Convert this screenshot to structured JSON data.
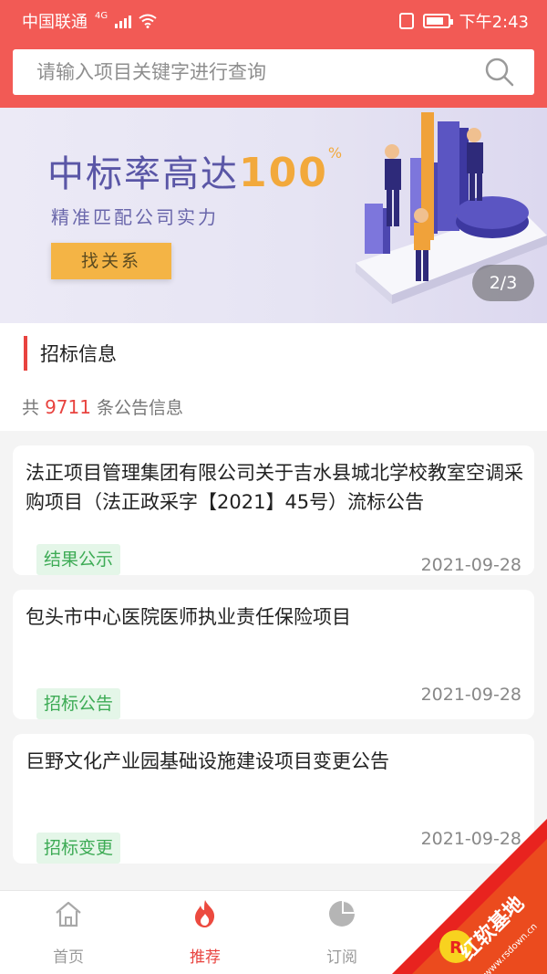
{
  "status_bar": {
    "carrier": "中国联通",
    "network": "4G",
    "time": "下午2:43"
  },
  "search": {
    "placeholder": "请输入项目关键字进行查询",
    "value": ""
  },
  "banner": {
    "title_prefix": "中标率高达",
    "title_highlight": "100",
    "title_percent": "%",
    "subtitle": "精准匹配公司实力",
    "button_label": "找关系",
    "pager": "2/3"
  },
  "section": {
    "title": "招标信息",
    "count_prefix": "共",
    "count": "9711",
    "count_suffix": "条公告信息"
  },
  "cards": [
    {
      "title": "法正项目管理集团有限公司关于吉水县城北学校教室空调采购项目（法正政采字【2021】45号）流标公告",
      "tag": "结果公示",
      "date": "2021-09-28"
    },
    {
      "title": "包头市中心医院医师执业责任保险项目",
      "tag": "招标公告",
      "date": "2021-09-28"
    },
    {
      "title": "巨野文化产业园基础设施建设项目变更公告",
      "tag": "招标变更",
      "date": "2021-09-28"
    }
  ],
  "nav": [
    {
      "label": "首页",
      "icon": "home-icon",
      "active": false
    },
    {
      "label": "推荐",
      "icon": "flame-icon",
      "active": true
    },
    {
      "label": "订阅",
      "icon": "pie-chart-icon",
      "active": false
    },
    {
      "label": "",
      "icon": "user-icon",
      "active": false
    }
  ],
  "watermark": {
    "brand": "红软基地",
    "url": "www.rsdown.cn"
  },
  "colors": {
    "header_red": "#f25a55",
    "accent_red": "#e8433f",
    "tag_green": "#3dab55",
    "banner_gold": "#f4b445",
    "banner_purple": "#5a56a6"
  }
}
